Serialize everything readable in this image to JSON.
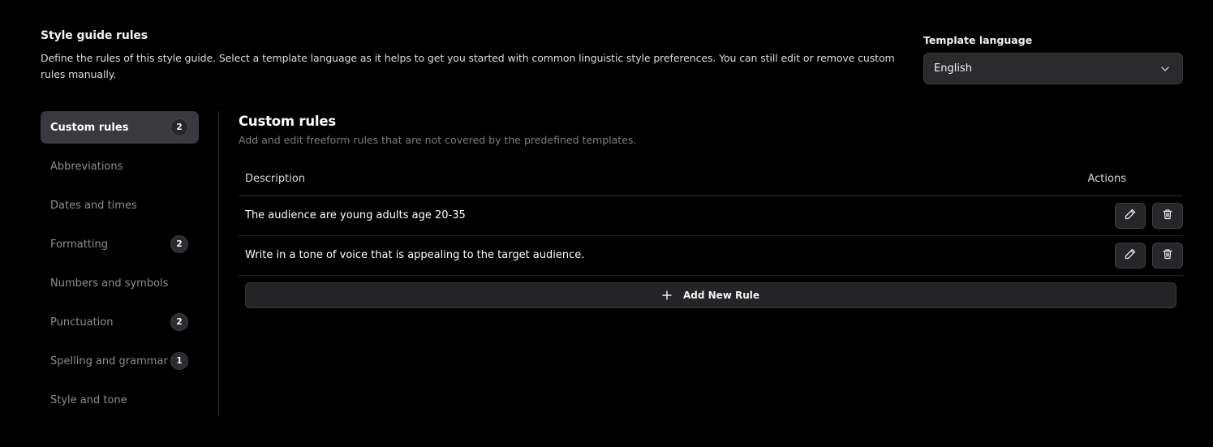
{
  "header": {
    "title": "Style guide rules",
    "description": "Define the rules of this style guide. Select a template language as it helps to get you started with common linguistic style preferences. You can still edit or remove custom rules manually."
  },
  "template_language": {
    "label": "Template language",
    "value": "English",
    "icon": "chevron-down-icon"
  },
  "sidebar": {
    "items": [
      {
        "label": "Custom rules",
        "count": "2",
        "active": true
      },
      {
        "label": "Abbreviations",
        "count": null,
        "active": false
      },
      {
        "label": "Dates and times",
        "count": null,
        "active": false
      },
      {
        "label": "Formatting",
        "count": "2",
        "active": false
      },
      {
        "label": "Numbers and symbols",
        "count": null,
        "active": false
      },
      {
        "label": "Punctuation",
        "count": "2",
        "active": false
      },
      {
        "label": "Spelling and grammar",
        "count": "1",
        "active": false
      },
      {
        "label": "Style and tone",
        "count": null,
        "active": false
      }
    ]
  },
  "main": {
    "title": "Custom rules",
    "subtitle": "Add and edit freeform rules that are not covered by the predefined templates.",
    "table": {
      "columns": [
        "Description",
        "Actions"
      ],
      "rows": [
        {
          "description": "The audience are young adults age 20-35"
        },
        {
          "description": "Write in a tone of voice that is appealing to the target audience."
        }
      ]
    },
    "add_button_label": "Add New Rule"
  },
  "colors": {
    "background": "#000000",
    "active_item": "#3a3a3e",
    "muted_text": "#8e8e93"
  }
}
